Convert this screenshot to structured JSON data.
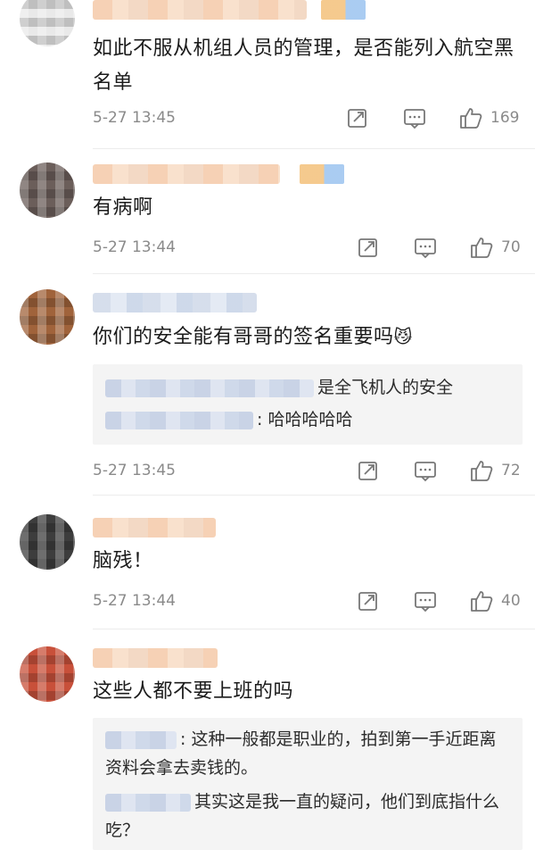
{
  "comments": [
    {
      "text": "如此不服从机组人员的管理，是否能列入航空黑名单",
      "time": "5-27 13:45",
      "likes": "169"
    },
    {
      "text": "有病啊",
      "time": "5-27 13:44",
      "likes": "70"
    },
    {
      "text": "你们的安全能有哥哥的签名重要吗",
      "emoji": "😼",
      "time": "5-27 13:45",
      "likes": "72",
      "replies": [
        "是全飞机人的安全",
        ": 哈哈哈哈哈"
      ]
    },
    {
      "text": "脑残！",
      "time": "5-27 13:44",
      "likes": "40"
    },
    {
      "text": "这些人都不要上班的吗",
      "replies": [
        ": 这种一般都是职业的，拍到第一手近距离资料会拿去卖钱的。",
        "其实这是我一直的疑问，他们到底指什么吃？"
      ]
    }
  ],
  "icons": {
    "share": "share-icon",
    "comment": "comment-icon",
    "like": "thumbs-up-icon"
  }
}
